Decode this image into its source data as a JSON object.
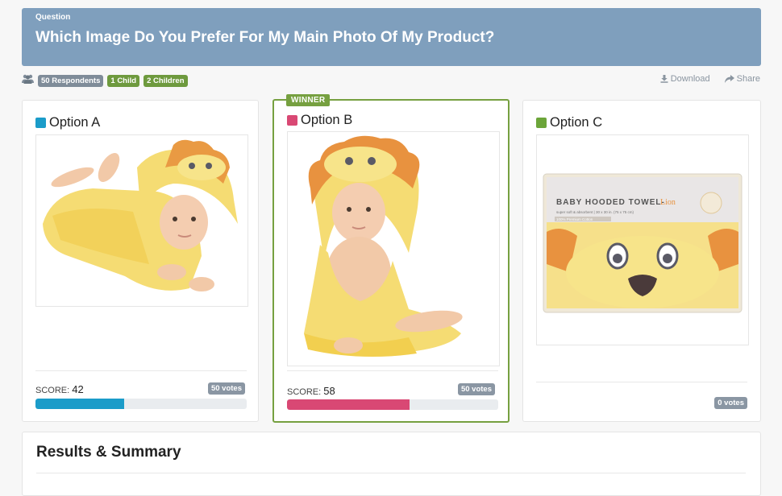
{
  "question": {
    "label": "Question",
    "title": "Which Image Do You Prefer For My Main Photo Of My Product?"
  },
  "meta": {
    "respondents": "50 Respondents",
    "children_1": "1 Child",
    "children_2": "2 Children"
  },
  "actions": {
    "download": "Download",
    "share": "Share"
  },
  "options": [
    {
      "title": "Option A",
      "color": "#1b9cc9",
      "score_label": "SCORE:",
      "score": "42",
      "votes": "50 votes",
      "progress": 0.42
    },
    {
      "title": "Option B",
      "color": "#d94874",
      "winner_label": "WINNER",
      "score_label": "SCORE:",
      "score": "58",
      "votes": "50 votes",
      "progress": 0.58
    },
    {
      "title": "Option C",
      "color": "#6ca53a",
      "votes": "0 votes",
      "product": {
        "name": "BABY HOODED TOWEL-",
        "variant": "Lion",
        "sub": "super soft & absorbent | 30 x 30 in. (75 x 75 cm)",
        "tag": "100% Premium Cotton"
      }
    }
  ],
  "results": {
    "title": "Results & Summary"
  },
  "icons": {
    "users": "users-icon",
    "download": "download-icon",
    "share": "share-icon"
  }
}
